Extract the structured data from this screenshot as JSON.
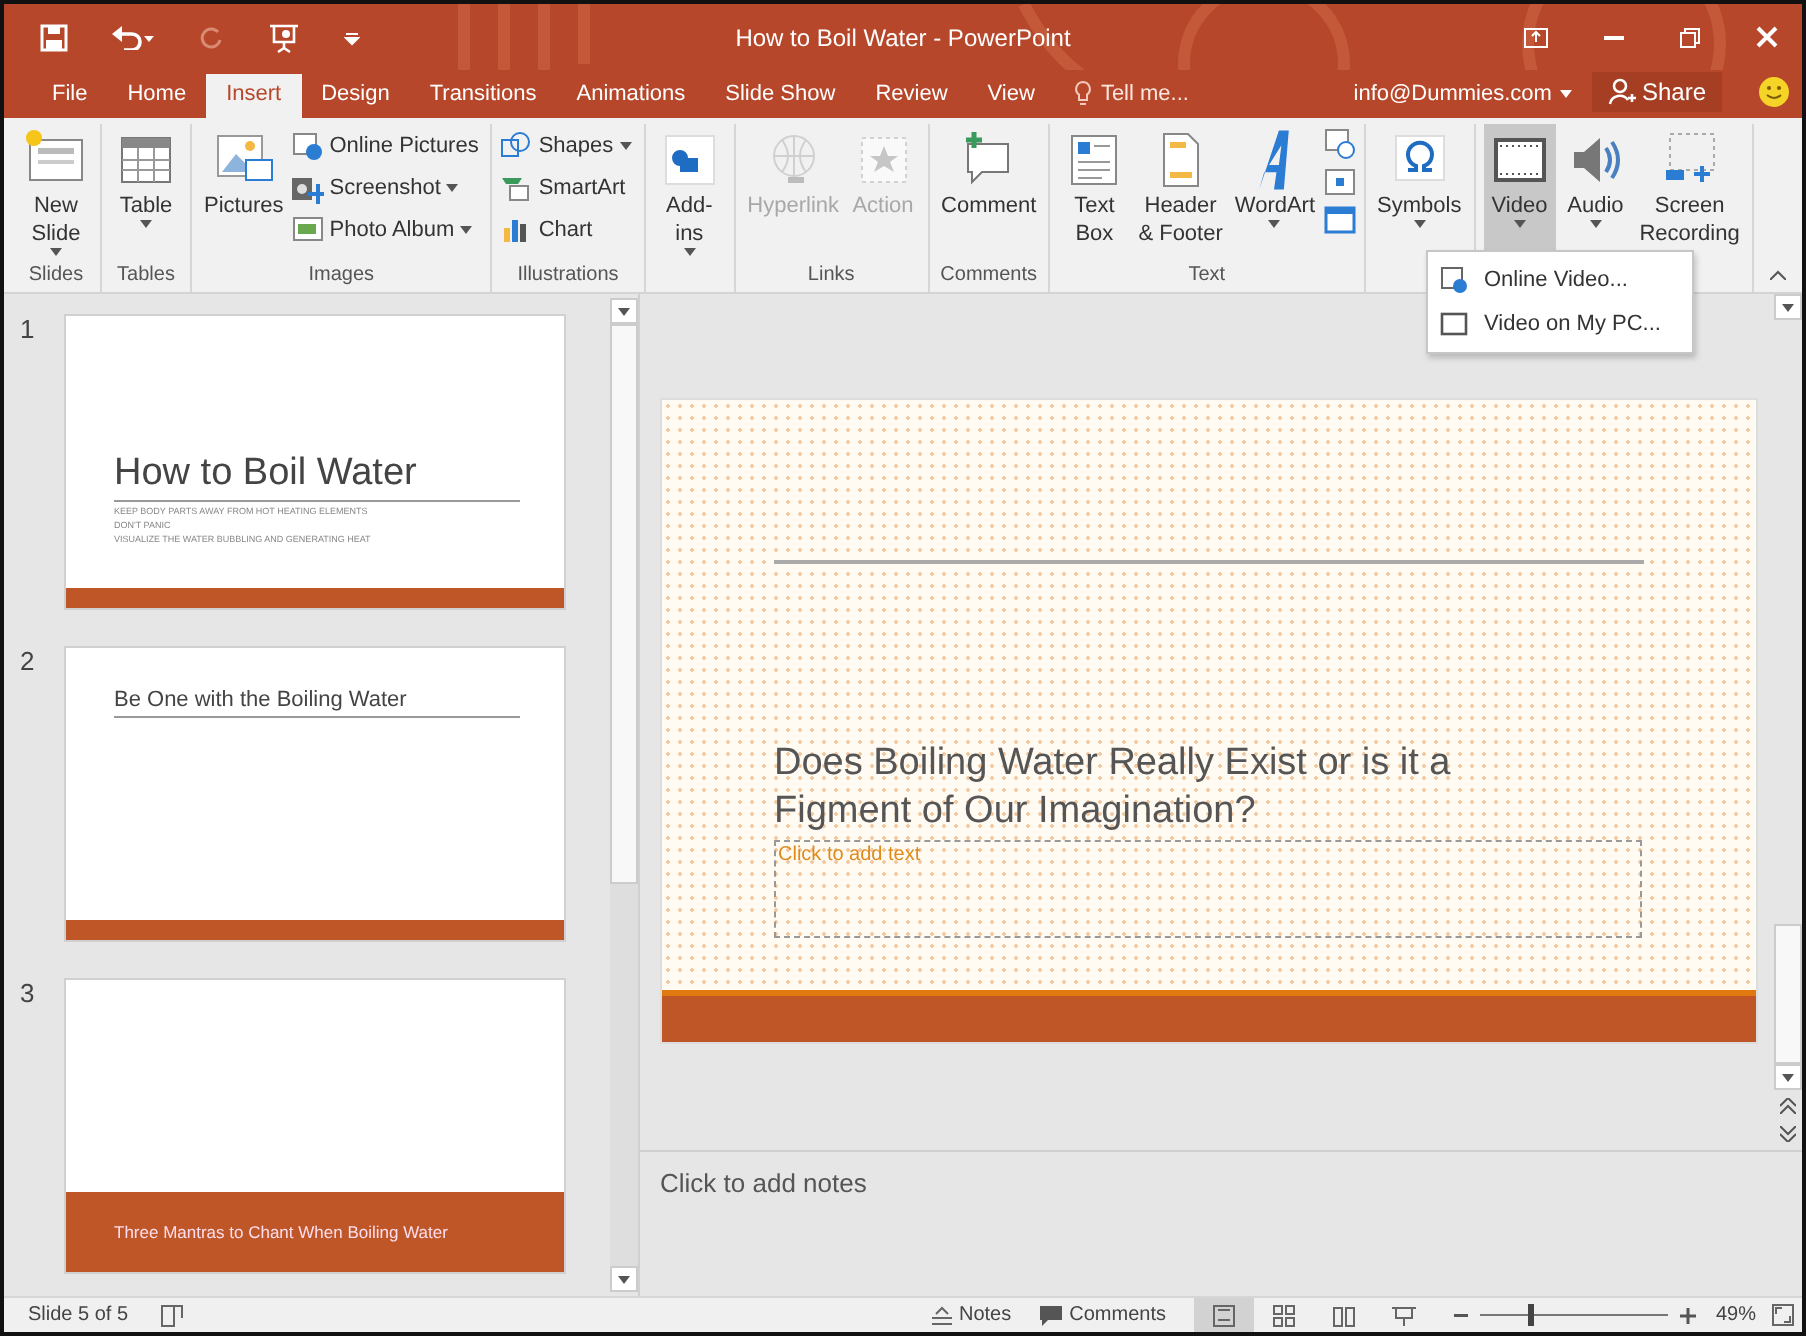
{
  "window": {
    "title": "How to Boil Water - PowerPoint"
  },
  "tabs": [
    {
      "label": "File",
      "selected": false
    },
    {
      "label": "Home",
      "selected": false
    },
    {
      "label": "Insert",
      "selected": true
    },
    {
      "label": "Design",
      "selected": false
    },
    {
      "label": "Transitions",
      "selected": false
    },
    {
      "label": "Animations",
      "selected": false
    },
    {
      "label": "Slide Show",
      "selected": false
    },
    {
      "label": "Review",
      "selected": false
    },
    {
      "label": "View",
      "selected": false
    }
  ],
  "tell_me": {
    "placeholder": "Tell me..."
  },
  "account": "info@Dummies.com",
  "share": "Share",
  "ribbon": [
    {
      "label": "Slides",
      "items": [
        {
          "kind": "large",
          "label": "New\nSlide",
          "dropdown": true,
          "disabled": false,
          "pressed": false
        }
      ]
    },
    {
      "label": "Tables",
      "items": [
        {
          "kind": "large",
          "label": "Table",
          "dropdown": true,
          "disabled": false,
          "pressed": false
        }
      ]
    },
    {
      "label": "Images",
      "items": [
        {
          "kind": "large",
          "label": "Pictures",
          "dropdown": false,
          "disabled": false,
          "pressed": false
        },
        {
          "kind": "small",
          "label": "Online Pictures",
          "dropdown": false,
          "disabled": false,
          "pressed": false
        },
        {
          "kind": "small",
          "label": "Screenshot",
          "dropdown": true,
          "disabled": false,
          "pressed": false
        },
        {
          "kind": "small",
          "label": "Photo Album",
          "dropdown": true,
          "disabled": false,
          "pressed": false
        }
      ]
    },
    {
      "label": "Illustrations",
      "items": [
        {
          "kind": "small",
          "label": "Shapes",
          "dropdown": true,
          "disabled": false,
          "pressed": false
        },
        {
          "kind": "small",
          "label": "SmartArt",
          "dropdown": false,
          "disabled": false,
          "pressed": false
        },
        {
          "kind": "small",
          "label": "Chart",
          "dropdown": false,
          "disabled": false,
          "pressed": false
        }
      ]
    },
    {
      "items": [
        {
          "kind": "large",
          "label": "Add-\nins",
          "dropdown": true,
          "disabled": false,
          "pressed": false
        }
      ]
    },
    {
      "label": "Links",
      "items": [
        {
          "kind": "large",
          "label": "Hyperlink",
          "dropdown": false,
          "disabled": true,
          "pressed": false
        },
        {
          "kind": "large",
          "label": "Action",
          "dropdown": false,
          "disabled": true,
          "pressed": false
        }
      ]
    },
    {
      "label": "Comments",
      "items": [
        {
          "kind": "large",
          "label": "Comment",
          "dropdown": false,
          "disabled": false,
          "pressed": false
        }
      ]
    },
    {
      "label": "Text",
      "items": [
        {
          "kind": "large",
          "label": "Text\nBox",
          "dropdown": false,
          "disabled": false,
          "pressed": false
        },
        {
          "kind": "large",
          "label": "Header\n& Footer",
          "dropdown": false,
          "disabled": false,
          "pressed": false
        },
        {
          "kind": "large",
          "label": "WordArt",
          "dropdown": true,
          "disabled": false,
          "pressed": false
        },
        {
          "kind": "icons"
        }
      ]
    },
    {
      "items": [
        {
          "kind": "large",
          "label": "Symbols",
          "dropdown": true,
          "disabled": false,
          "pressed": false
        }
      ]
    },
    {
      "items": [
        {
          "kind": "large",
          "label": "Video",
          "dropdown": true,
          "disabled": false,
          "pressed": true
        },
        {
          "kind": "large",
          "label": "Audio",
          "dropdown": true,
          "disabled": false,
          "pressed": false
        },
        {
          "kind": "large",
          "label": "Screen\nRecording",
          "dropdown": false,
          "disabled": false,
          "pressed": false
        }
      ]
    }
  ],
  "video_menu": [
    "Online Video...",
    "Video on My PC..."
  ],
  "thumbnails": [
    {
      "number": "1",
      "kind": "title",
      "title": "How to Boil Water",
      "subtitle": [
        "KEEP BODY PARTS AWAY FROM HOT HEATING ELEMENTS",
        "DON'T PANIC",
        "VISUALIZE THE WATER BUBBLING AND GENERATING HEAT"
      ]
    },
    {
      "number": "2",
      "kind": "content",
      "title": "Be One with the Boiling Water"
    },
    {
      "number": "3",
      "kind": "section",
      "title": "Three Mantras to Chant When Boiling Water"
    }
  ],
  "slide": {
    "title": "Does Boiling Water Really Exist or is it a Figment of Our Imagination?",
    "placeholder": "Click to add text"
  },
  "notes": {
    "placeholder": "Click to add notes"
  },
  "status_bar": {
    "slide": "Slide 5 of 5",
    "notes": "Notes",
    "comments": "Comments",
    "views": [
      {
        "selected": true
      },
      {
        "selected": false
      },
      {
        "selected": false
      },
      {
        "selected": false
      }
    ],
    "zoom": {
      "level": 0.26,
      "reading": "49%"
    }
  }
}
